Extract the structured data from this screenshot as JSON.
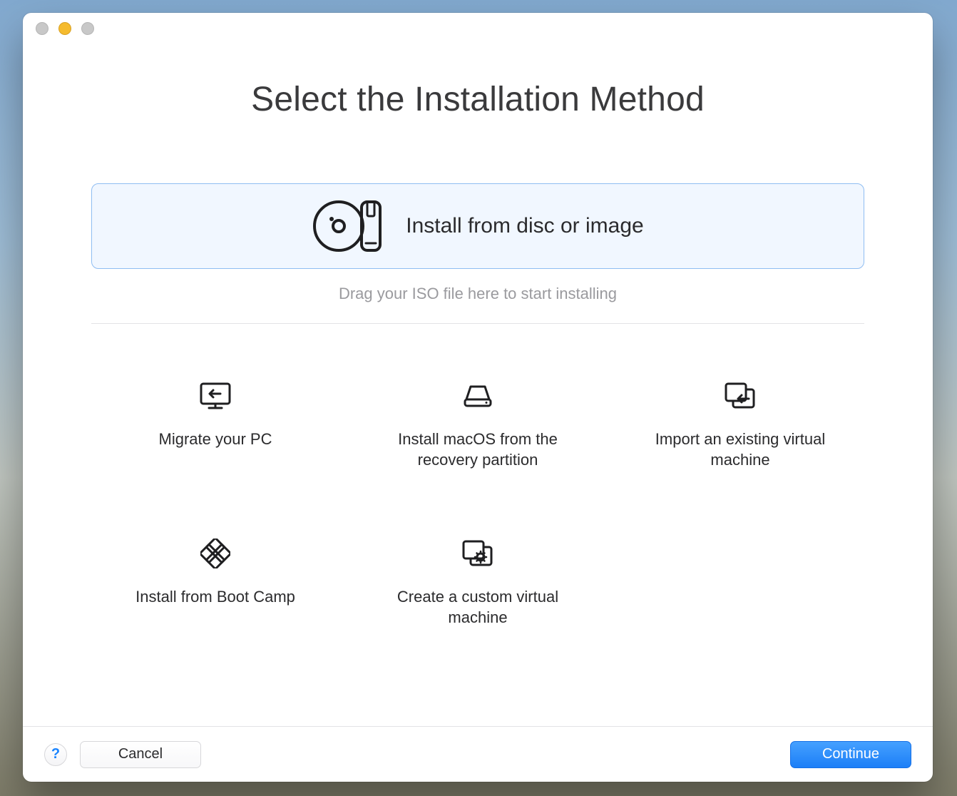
{
  "window": {
    "title": "Select the Installation Method"
  },
  "primary": {
    "label": "Install from disc or image",
    "hint": "Drag your ISO file here to start installing"
  },
  "options": [
    {
      "icon": "migrate-pc-icon",
      "label": "Migrate your PC"
    },
    {
      "icon": "disk-icon",
      "label": "Install macOS from the recovery partition"
    },
    {
      "icon": "import-vm-icon",
      "label": "Import an existing virtual machine"
    },
    {
      "icon": "bootcamp-icon",
      "label": "Install from Boot Camp"
    },
    {
      "icon": "custom-vm-icon",
      "label": "Create a custom virtual machine"
    }
  ],
  "footer": {
    "help": "?",
    "cancel": "Cancel",
    "continue": "Continue"
  }
}
